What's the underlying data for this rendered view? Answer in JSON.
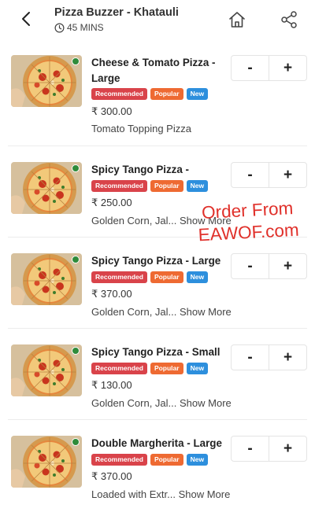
{
  "header": {
    "store_name": "Pizza Buzzer - Khatauli",
    "eta": "45 MINS"
  },
  "badges": {
    "recommended": "Recommended",
    "popular": "Popular",
    "new": "New"
  },
  "stepper": {
    "minus": "-",
    "plus": "+"
  },
  "items": [
    {
      "name": "Cheese & Tomato Pizza - Large",
      "price": "₹ 300.00",
      "desc": "Tomato Topping Pizza",
      "show_more": ""
    },
    {
      "name": "Spicy Tango Pizza - Medium",
      "price": "₹ 250.00",
      "desc": "Golden Corn, Jal...",
      "show_more": "Show More"
    },
    {
      "name": "Spicy Tango Pizza - Large",
      "price": "₹ 370.00",
      "desc": "Golden Corn, Jal...",
      "show_more": "Show More"
    },
    {
      "name": "Spicy Tango Pizza - Small",
      "price": "₹ 130.00",
      "desc": "Golden Corn, Jal...",
      "show_more": "Show More"
    },
    {
      "name": "Double Margherita - Large",
      "price": "₹ 370.00",
      "desc": "Loaded with Extr...",
      "show_more": "Show More"
    }
  ],
  "watermark": {
    "line1": "Order From",
    "line2": "EAWOF.com"
  },
  "colors": {
    "recommended": "#d9434a",
    "popular": "#ee6a32",
    "new": "#2d8fdd",
    "veg": "#2e8b3a",
    "watermark": "#e0302a"
  },
  "icons": [
    "back-arrow-icon",
    "clock-icon",
    "home-icon",
    "share-icon",
    "veg-indicator-icon"
  ]
}
